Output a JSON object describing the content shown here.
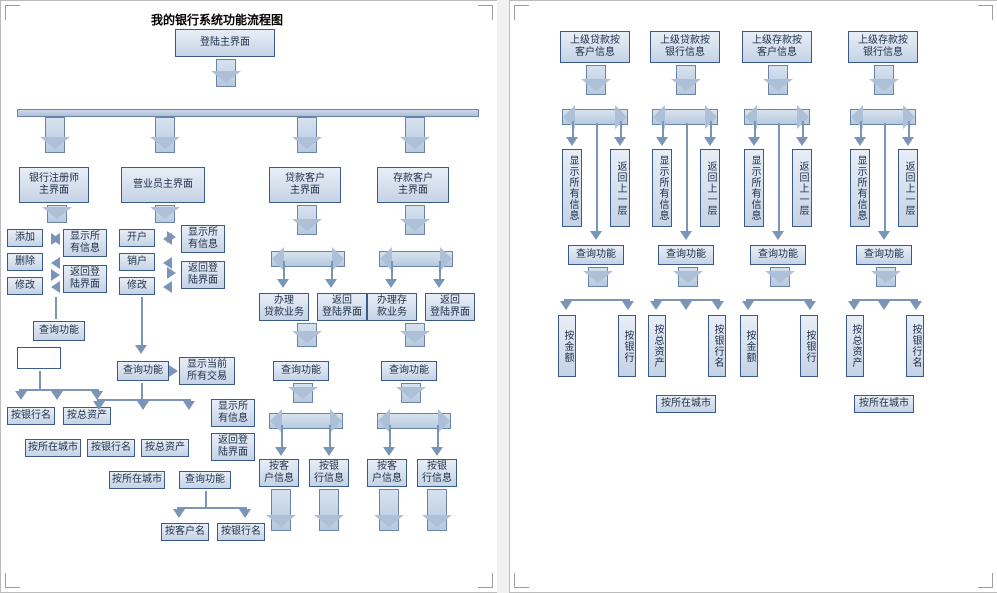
{
  "title": "我的银行系统功能流程图",
  "pageA": {
    "root": "登陆主界面",
    "branches": {
      "b1": {
        "head": "银行注册师\n主界面",
        "left": [
          "添加",
          "删除",
          "修改"
        ],
        "right": [
          "显示所\n有信息",
          "返回登\n陆界面"
        ],
        "query": "查询功能",
        "qchildren": [
          "按银行名",
          "按总资产",
          "按所在城市"
        ]
      },
      "b2": {
        "head": "营业员主界面",
        "left": [
          "开户",
          "销户",
          "修改"
        ],
        "right": [
          "显示所\n有信息",
          "返回登\n陆界面"
        ],
        "query": "查询功能",
        "qside": "显示当前\n所有交易",
        "q2": [
          "显示所\n有信息",
          "返回登\n陆界面"
        ],
        "q2label": "查询功能",
        "qchildren": [
          "按银行名",
          "按总资产",
          "按所在城市"
        ],
        "q3children": [
          "按客户名",
          "按银行名"
        ]
      },
      "b3": {
        "head": "贷款客户\n主界面",
        "pair": [
          "办理\n贷款业务",
          "返回\n登陆界面"
        ],
        "query": "查询功能",
        "qchildren": [
          "按客\n户信息",
          "按银\n行信息"
        ]
      },
      "b4": {
        "head": "存款客户\n主界面",
        "pair": [
          "办理存\n款业务",
          "返回\n登陆界面"
        ],
        "query": "查询功能",
        "qchildren": [
          "按客\n户信息",
          "按银\n行信息"
        ]
      }
    }
  },
  "pageB": {
    "cols": [
      {
        "head": "上级贷款按\n客户信息",
        "left": "显示所有信息",
        "right": "返回上一层",
        "query": "查询功能",
        "children": [
          "按金额",
          "按银行"
        ]
      },
      {
        "head": "上级贷款按\n银行信息",
        "left": "显示所有信息",
        "right": "返回上一层",
        "query": "查询功能",
        "children": [
          "按总资产",
          "按银行名"
        ],
        "extra": "按所在城市"
      },
      {
        "head": "上级存款按\n客户信息",
        "left": "显示所有信息",
        "right": "返回上一层",
        "query": "查询功能",
        "children": [
          "按金额",
          "按银行"
        ]
      },
      {
        "head": "上级存款按\n银行信息",
        "left": "显示所有信息",
        "right": "返回上一层",
        "query": "查询功能",
        "children": [
          "按总资产",
          "按银行名"
        ],
        "extra": "按所在城市"
      }
    ]
  }
}
